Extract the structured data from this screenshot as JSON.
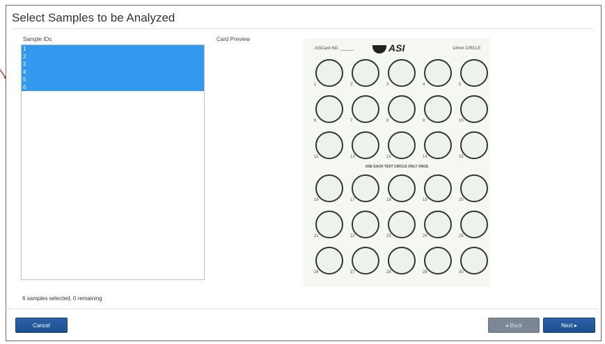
{
  "window": {
    "title": "Select Samples to be Analyzed"
  },
  "sample_list": {
    "label": "Sample IDs",
    "items": [
      "1",
      "2",
      "3",
      "4",
      "5",
      "6"
    ]
  },
  "preview": {
    "label": "Card Preview",
    "card": {
      "card_no_label": "ASICard NO. ______",
      "logo_text": "ASI",
      "circle_size_label": "14mm CIRCLE",
      "middle_text": "USE EACH TEST CIRCLE ONLY ONCE",
      "circle_numbers": [
        "1",
        "2",
        "3",
        "4",
        "5",
        "6",
        "7",
        "8",
        "9",
        "10",
        "11",
        "12",
        "13",
        "14",
        "15",
        "16",
        "17",
        "18",
        "19",
        "20",
        "21",
        "22",
        "23",
        "24",
        "25",
        "26",
        "27",
        "28",
        "29",
        "30"
      ]
    }
  },
  "status": {
    "text": "6 samples selected, 0 remaining"
  },
  "buttons": {
    "cancel": "Cancel",
    "back": "◂ Back",
    "next": "Next ▸"
  },
  "colors": {
    "selection": "#3399ee",
    "primary_button": "#1f5597",
    "disabled_button": "#7b8794",
    "indicator_arrow": "#c0392b"
  }
}
